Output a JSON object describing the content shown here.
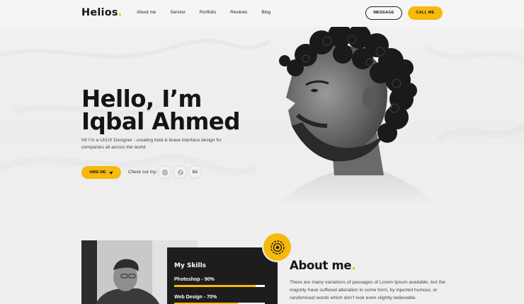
{
  "header": {
    "logo_text": "Helios",
    "logo_dot": ".",
    "nav": [
      "About me",
      "Service",
      "Portfolio",
      "Reviews",
      "Blog"
    ],
    "message_label": "MESSAGE",
    "call_label": "CALL ME"
  },
  "hero": {
    "title_line1": "Hello, I’m",
    "title_line2": "Iqbal Ahmed",
    "description": "Hi! I’m a UI/UX Designer - creating bold & brave interface design for companies all across the world.",
    "hire_label": "HIRE ME",
    "checkout_label": "Check out my:",
    "socials": [
      "instagram-icon",
      "dribbble-icon",
      "behance-icon"
    ],
    "behance_text": "Bē"
  },
  "about": {
    "skills_title": "My Skills",
    "skills": [
      {
        "label": "Photoshop - 90%",
        "value": 0.9
      },
      {
        "label": "Web Design - 70%",
        "value": 0.7
      }
    ],
    "title": "About me",
    "title_dot": ".",
    "text": "There are many variations of passages of Lorem Ipsum available, but the majority have suffered alteration in some form, by injected humour, or randomised words which don’t look even slightly believable."
  },
  "colors": {
    "accent": "#f6b90c",
    "dark": "#1d1d1d"
  }
}
